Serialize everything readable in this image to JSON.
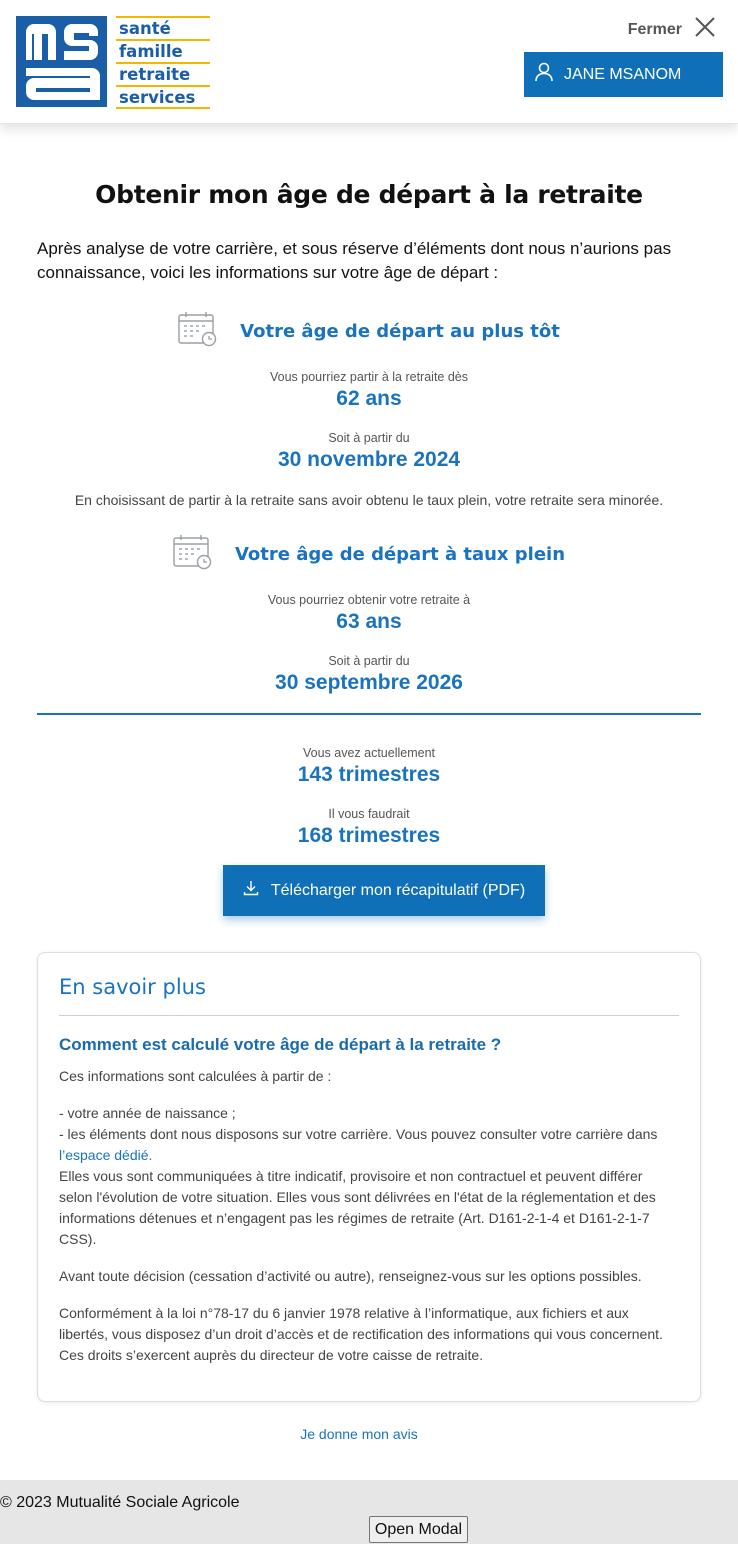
{
  "header": {
    "logo_lines": [
      "santé",
      "famille",
      "retraite",
      "services"
    ],
    "logo_mark": "msa",
    "close_label": "Fermer",
    "user_name": "JANE MSANOM",
    "icons": {
      "close": "close-icon",
      "user": "user-icon"
    }
  },
  "main": {
    "title": "Obtenir mon âge de départ à la retraite",
    "intro": "Après analyse de votre carrière, et sous réserve d’éléments dont nous n’aurions pas connaissance, voici les informations sur votre âge de départ :",
    "earliest": {
      "title": "Votre âge de départ au plus tôt",
      "age_label": "Vous pourriez partir à la retraite dès",
      "age_value": "62 ans",
      "date_label": "Soit à partir du",
      "date_value": "30 novembre 2024",
      "note": "En choisissant de partir à la retraite sans avoir obtenu le taux plein, votre retraite sera minorée."
    },
    "full_rate": {
      "title": "Votre âge de départ à taux plein",
      "age_label": "Vous pourriez obtenir votre retraite à",
      "age_value": "63 ans",
      "date_label": "Soit à partir du",
      "date_value": "30 septembre 2026"
    },
    "quarters": {
      "current_label": "Vous avez actuellement",
      "current_value": "143 trimestres",
      "required_label": "Il vous faudrait",
      "required_value": "168 trimestres"
    },
    "download_label": "Télécharger mon récapitulatif (PDF)"
  },
  "card": {
    "title": "En savoir plus",
    "subtitle": "Comment est calculé votre âge de départ à la retraite ?",
    "p1": "Ces informations sont calculées à partir de :",
    "p2_line1": "- votre année de naissance ;",
    "p2_line2": "- les éléments dont nous disposons sur votre carrière. Vous pouvez consulter votre carrière dans ",
    "p2_link": "l’espace dédié",
    "p2_after_link": ".",
    "p2_rest": "Elles vous sont communiquées à titre indicatif, provisoire et non contractuel et peuvent différer selon l'évolution de votre situation. Elles vous sont délivrées en l'état de la réglementation et des informations détenues et n’engagent pas les régimes de retraite (Art. D161-2-1-4 et D161-2-1-7 CSS).",
    "p3": "Avant toute décision (cessation d’activité ou autre), renseignez-vous sur les options possibles.",
    "p4": "Conformément à la loi n°78-17 du 6 janvier 1978 relative à l’informatique, aux fichiers et aux libertés, vous disposez d’un droit d’accès et de rectification des informations qui vous concernent. Ces droits s’exercent auprès du directeur de votre caisse de retraite."
  },
  "feedback_link": "Je donne mon avis",
  "footer": {
    "copyright": "© 2023 Mutualité Sociale Agricole",
    "modal_button": "Open Modal"
  },
  "colors": {
    "brand_blue": "#1a5ea8",
    "accent_blue": "#1a73be",
    "button_blue": "#0f70b7",
    "logo_yellow": "#f2b800"
  }
}
